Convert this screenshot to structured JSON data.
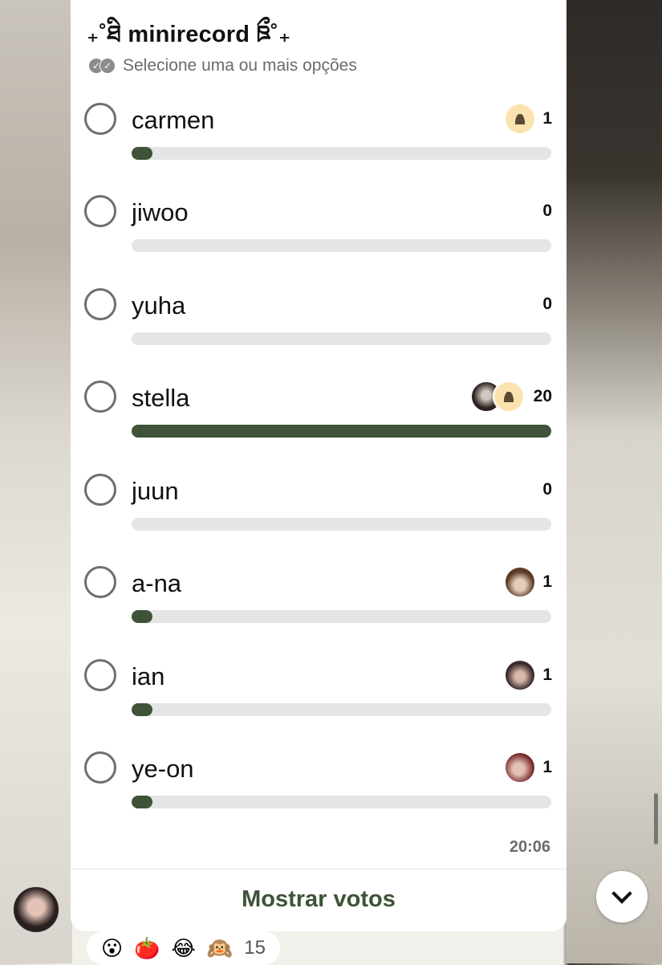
{
  "poll": {
    "title": "₊˚ཐི minirecord ཋྀ˚₊",
    "hint": "Selecione uma ou mais opções",
    "options": [
      {
        "label": "carmen",
        "count": "1",
        "fraction": 0.05,
        "voters": [
          "anonymous-avatar"
        ]
      },
      {
        "label": "jiwoo",
        "count": "0",
        "fraction": 0,
        "voters": []
      },
      {
        "label": "yuha",
        "count": "0",
        "fraction": 0,
        "voters": []
      },
      {
        "label": "stella",
        "count": "20",
        "fraction": 1.0,
        "voters": [
          "photo-avatar",
          "anonymous-avatar"
        ]
      },
      {
        "label": "juun",
        "count": "0",
        "fraction": 0,
        "voters": []
      },
      {
        "label": "a-na",
        "count": "1",
        "fraction": 0.05,
        "voters": [
          "photo-avatar"
        ]
      },
      {
        "label": "ian",
        "count": "1",
        "fraction": 0.05,
        "voters": [
          "photo-avatar"
        ]
      },
      {
        "label": "ye-on",
        "count": "1",
        "fraction": 0.05,
        "voters": [
          "photo-avatar"
        ]
      }
    ],
    "time": "20:06",
    "show_votes": "Mostrar votos"
  },
  "reactions": {
    "emojis": [
      "😮",
      "🍅",
      "😂",
      "🙉"
    ],
    "count": "15"
  },
  "colors": {
    "accent": "#3e5337",
    "track": "#e5e5e5"
  }
}
